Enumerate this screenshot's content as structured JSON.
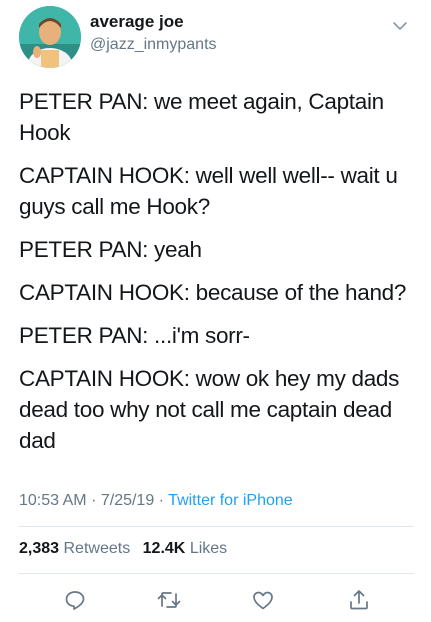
{
  "user": {
    "display_name": "average joe",
    "handle": "@jazz_inmypants",
    "avatar_icon": "avatar-photo"
  },
  "tweet": {
    "paragraphs": [
      "PETER PAN: we meet again, Captain\nHook",
      "CAPTAIN HOOK: well well well-- wait u\nguys call me Hook?",
      "PETER PAN: yeah",
      "CAPTAIN HOOK: because of the hand?",
      "PETER PAN: ...i'm sorr-",
      "CAPTAIN HOOK: wow ok hey my dads\ndead too why not call me captain dead\ndad"
    ],
    "time": "10:53 AM",
    "date": "7/25/19",
    "separator": "·",
    "source": "Twitter for iPhone"
  },
  "stats": {
    "retweets_count": "2,383",
    "retweets_label": "Retweets",
    "likes_count": "12.4K",
    "likes_label": "Likes"
  },
  "actions": {
    "reply_icon": "reply-icon",
    "retweet_icon": "retweet-icon",
    "like_icon": "heart-icon",
    "share_icon": "share-icon"
  },
  "colors": {
    "text": "#14171a",
    "secondary": "#657786",
    "accent": "#1da1f2",
    "divider": "#e1e8ed"
  }
}
